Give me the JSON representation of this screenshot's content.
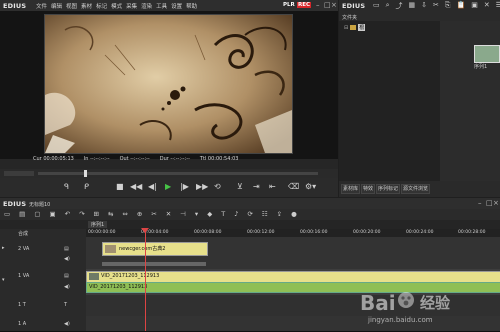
{
  "player": {
    "logo": "EDIUS",
    "menu": [
      "文件",
      "编辑",
      "视图",
      "素材",
      "标记",
      "模式",
      "采集",
      "渲染",
      "工具",
      "设置",
      "帮助"
    ],
    "plr": "PLR",
    "rec": "REC",
    "cur_label": "Cur",
    "cur_value": "00:00:05:13",
    "in_label": "In",
    "in_value": "--:--:--:--",
    "out_label": "Out",
    "out_value": "--:--:--:--",
    "dur_label": "Dur",
    "dur_value": "--:--:--:--",
    "ttl_label": "Ttl",
    "ttl_value": "00:00:54:03"
  },
  "bin": {
    "title": "文件夹",
    "root_label": "根",
    "thumb_label": "序列1",
    "tabs": [
      "素材库",
      "特效",
      "序列标记",
      "源文件浏览"
    ]
  },
  "timeline": {
    "logo": "EDIUS",
    "project_name": "无标题10",
    "sequence_tab": "序列1",
    "ruler": [
      "00:00:00:00",
      "00:00:04:00",
      "00:00:08:00",
      "00:00:12:00",
      "00:00:16:00",
      "00:00:20:00",
      "00:00:24:00",
      "00:00:28:00"
    ],
    "header_row_label": "合成",
    "tracks": [
      {
        "name": "2 VA",
        "type": "video"
      },
      {
        "name": "1 VA",
        "type": "video"
      },
      {
        "name": "1 T",
        "type": "title"
      },
      {
        "name": "1 A",
        "type": "audio"
      }
    ],
    "clips": {
      "track2_clip": "newcger.com古典2",
      "track1_clip_top": "VID_20171203_112913",
      "track1_clip_bottom": "VID_20171203_112913"
    }
  },
  "watermark": {
    "brand_cn": "经验",
    "url": "jingyan.baidu.com"
  },
  "colors": {
    "rec_red": "#d8262a",
    "plr_white": "#ffffff",
    "clip_yellow": "#e7e08b",
    "clip_green": "#8fbf55",
    "play_green": "#47c447",
    "playhead": "#d44"
  }
}
